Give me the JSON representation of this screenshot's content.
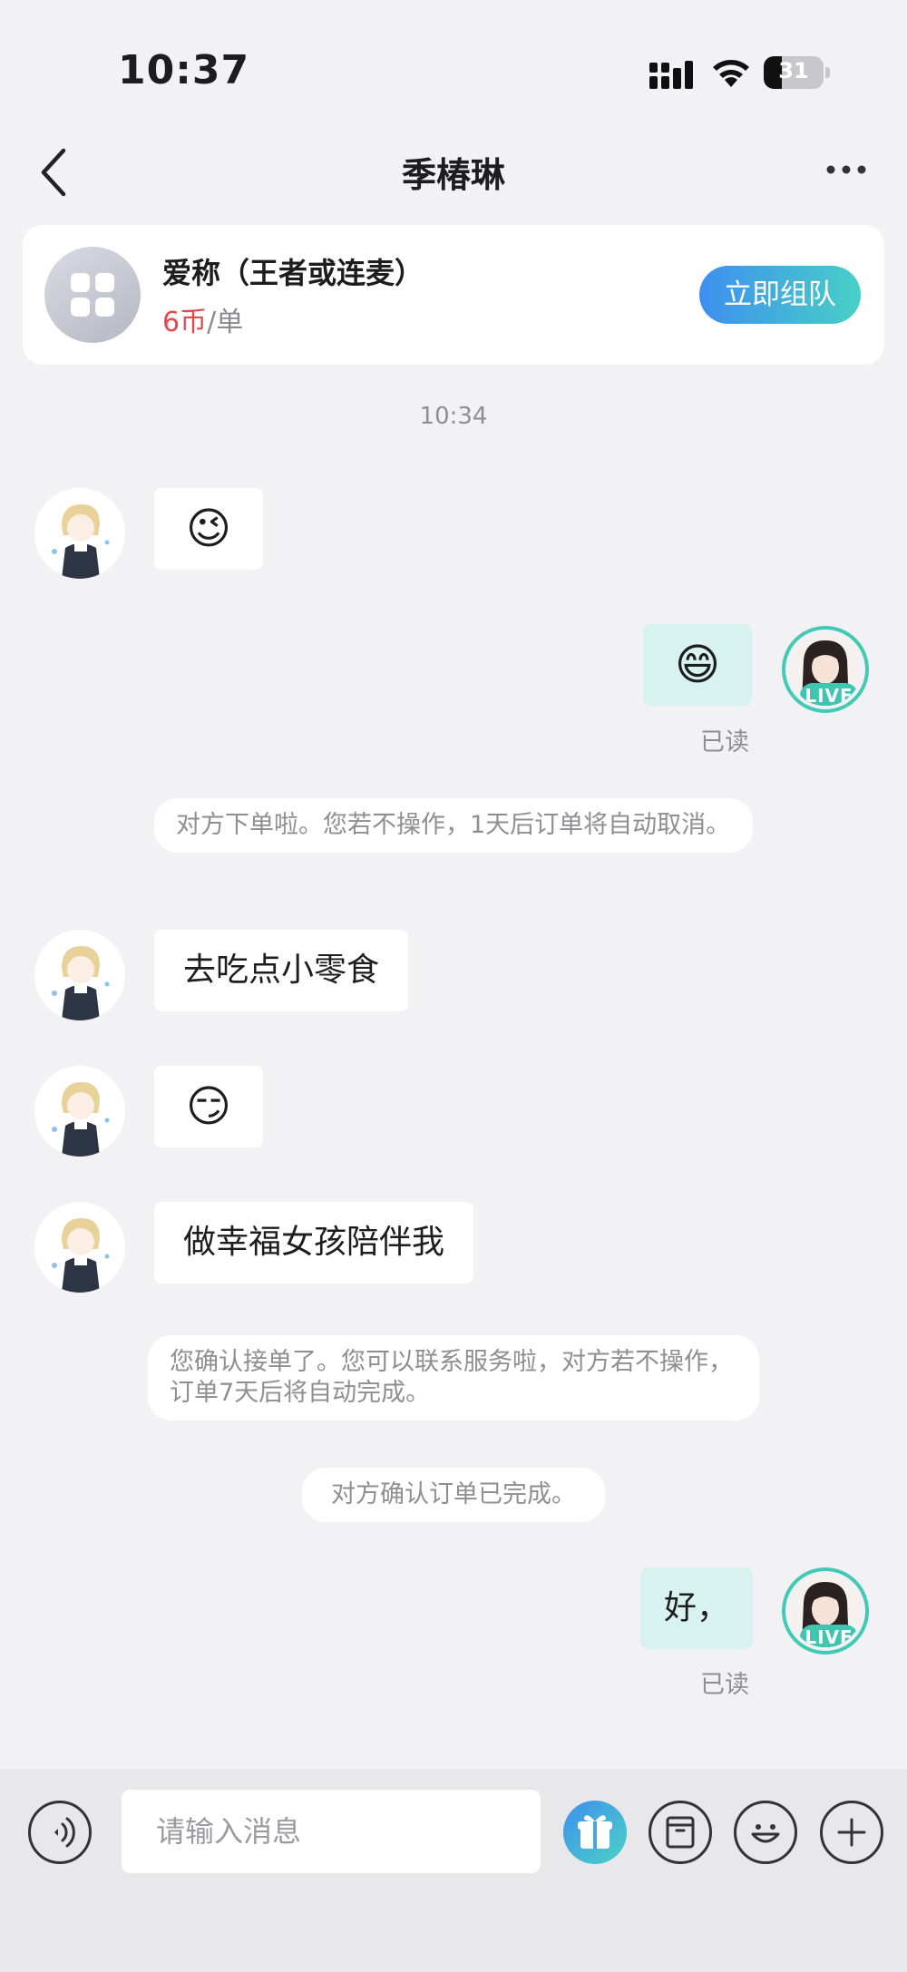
{
  "status_bar": {
    "time": "10:37",
    "battery_level": "31"
  },
  "nav": {
    "title": "季椿琳"
  },
  "order_card": {
    "title": "爱称（王者或连麦）",
    "price_amount": "6币",
    "price_unit": "/单",
    "action_label": "立即组队"
  },
  "chat": {
    "timestamp": "10:34",
    "read_label": "已读",
    "live_badge": "LIVE",
    "messages": [
      {
        "side": "left",
        "type": "emoji",
        "text": "😉"
      },
      {
        "side": "right",
        "type": "emoji",
        "text": "😄"
      },
      {
        "side": "system",
        "text": "对方下单啦。您若不操作，1天后订单将自动取消。"
      },
      {
        "side": "left",
        "type": "text",
        "text": "去吃点小零食"
      },
      {
        "side": "left",
        "type": "emoji",
        "text": "😏"
      },
      {
        "side": "left",
        "type": "text",
        "text": "做幸福女孩陪伴我"
      },
      {
        "side": "system",
        "text": "您确认接单了。您可以联系服务啦，对方若不操作，订单7天后将自动完成。"
      },
      {
        "side": "system",
        "text": "对方确认订单已完成。"
      },
      {
        "side": "right",
        "type": "text",
        "text": "好，"
      }
    ]
  },
  "input_bar": {
    "placeholder": "请输入消息",
    "icons": [
      "voice-icon",
      "gift-icon",
      "order-icon",
      "emoji-icon",
      "plus-icon"
    ]
  },
  "colors": {
    "accent_start": "#3e8ff0",
    "accent_end": "#48d0c6",
    "price": "#e5484d",
    "sent_bubble": "#d7f2ef",
    "live_ring": "#43c9b4"
  }
}
